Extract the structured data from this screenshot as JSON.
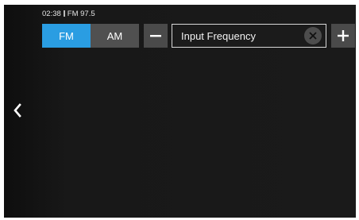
{
  "status": {
    "time": "02:38",
    "station": "FM 97.5"
  },
  "band": {
    "options": [
      "FM",
      "AM"
    ],
    "selected": "FM"
  },
  "frequency_input": {
    "placeholder": "Input Frequency"
  },
  "icons": {
    "decrease": "minus-icon",
    "increase": "plus-icon",
    "clear": "clear-x-icon",
    "back": "chevron-left-icon"
  },
  "colors": {
    "accent": "#2a9de2",
    "background": "#1a1a1a",
    "button": "#4a4a4a"
  }
}
